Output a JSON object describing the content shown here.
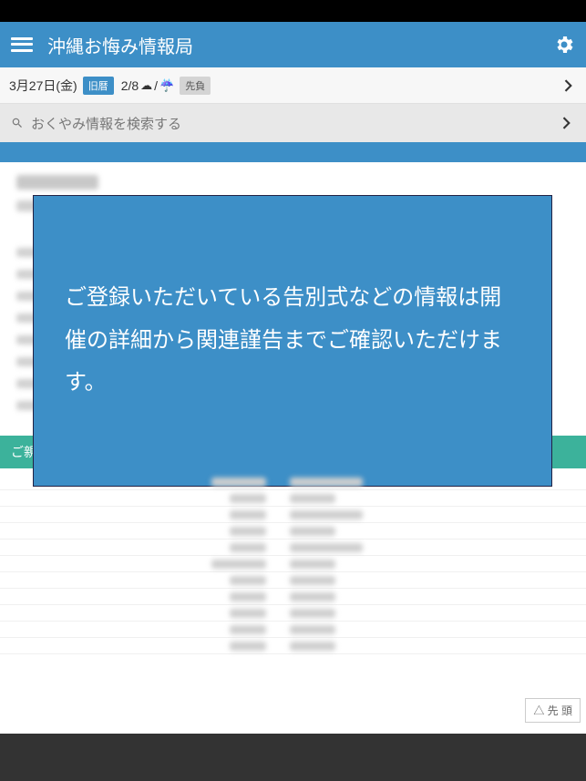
{
  "header": {
    "title": "沖縄お悔み情報局"
  },
  "infobar": {
    "date": "3月27日(金)",
    "calendar_badge": "旧暦",
    "lunar": "2/8",
    "weather1": "☁",
    "weather_sep": "/",
    "weather2": "☔",
    "fortune": "先負"
  },
  "search": {
    "placeholder": "おくやみ情報を検索する"
  },
  "modal": {
    "text": "ご登録いただいている告別式などの情報は開催の詳細から関連謹告までご確認いただけます。"
  },
  "section": {
    "family_header": "ご親族様"
  },
  "buttons": {
    "to_top": "△ 先 頭"
  }
}
